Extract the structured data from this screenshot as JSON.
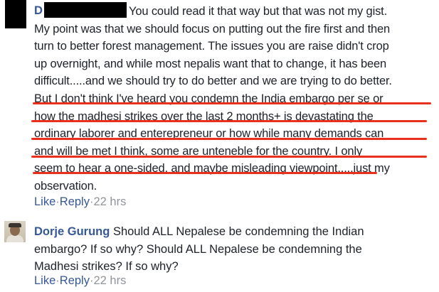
{
  "comment1": {
    "author_initial": "D",
    "lines": [
      "You could read it that way but that was not my gist.",
      "My point was that we should focus on putting out the fire first and then",
      "turn to better forest management. The issues you are raise didn't crop",
      "up overnight, and while most nepalis want that to change, it has been",
      "difficult.....and we should try to do better and we are trying to do better.",
      "But I don't think I've heard you condemn the India embargo per se or",
      "how the madhesi strikes over the last 2 months+ is devastating the",
      "ordinary laborer and enterepreneur or how while many demands can",
      "and will be met I think, some are unteneble for the country. I only",
      "seem to hear a one-sided, and maybe misleading viewpoint.....just my",
      "observation."
    ],
    "actions": {
      "like": "Like",
      "sep1": " · ",
      "reply": "Reply",
      "sep2": " · ",
      "time": "22 hrs"
    }
  },
  "comment2": {
    "author_name": "Dorje Gurung",
    "lines": [
      "Should ALL Nepalese be condemning the Indian",
      "embargo? If so why? Should ALL Nepalese be condemning the",
      "Madhesi strikes? If so why?"
    ],
    "actions": {
      "like": "Like",
      "sep1": " · ",
      "reply": "Reply",
      "sep2": " · ",
      "time": "22 hrs"
    }
  },
  "colors": {
    "link": "#365899",
    "text": "#1d2129",
    "meta": "#90949c",
    "annotation_underline": "#e8301c"
  }
}
